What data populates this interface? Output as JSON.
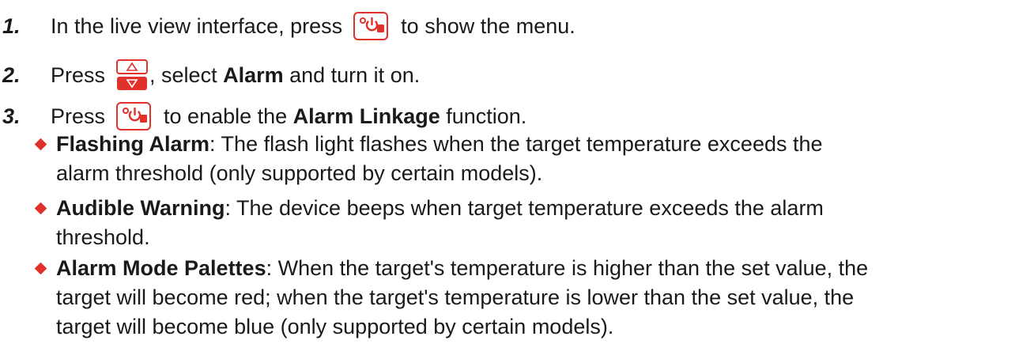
{
  "steps": [
    {
      "number": "1.",
      "text_before": "In the live view interface, press",
      "button_icon": "power-button-icon",
      "text_after": "to show the menu."
    },
    {
      "number": "2.",
      "text_before": "Press",
      "button_icon": "up-down-button-icon",
      "text_mid": ", select ",
      "bold": "Alarm",
      "text_after": " and turn it on."
    },
    {
      "number": "3.",
      "text_before": "Press",
      "button_icon": "power-button-icon",
      "text_mid": "to enable the ",
      "bold": "Alarm Linkage",
      "text_after": " function."
    }
  ],
  "linkage_options": [
    {
      "title": "Flashing Alarm",
      "lines": [
        ": The flash light flashes when the target temperature exceeds the",
        "alarm threshold (only supported by certain models)."
      ]
    },
    {
      "title": "Audible Warning",
      "lines": [
        ": The device beeps when target temperature exceeds the alarm",
        "threshold."
      ]
    },
    {
      "title": "Alarm Mode Palettes",
      "lines": [
        ": When the target's temperature is higher than the set value, the",
        "target will become red; when the target's temperature is lower than the set value, the",
        "target will become blue (only supported by certain models)."
      ]
    }
  ],
  "colors": {
    "accent": "#e0312b",
    "text": "#1a1a1a"
  }
}
